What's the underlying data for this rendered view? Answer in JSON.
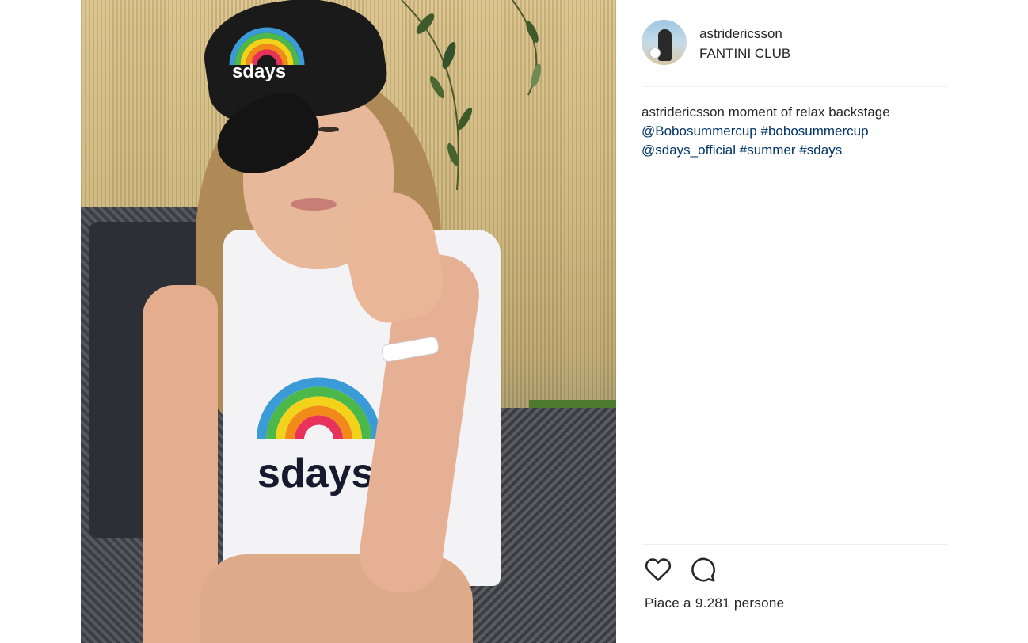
{
  "post": {
    "photo_icon": "post-photo",
    "cap_logo_text": "sdays",
    "shirt_logo_text": "sdays"
  },
  "header": {
    "username": "astridericsson",
    "location": "FANTINI CLUB",
    "avatar_icon": "avatar"
  },
  "caption": {
    "author": "astridericsson",
    "text": "moment of relax backstage",
    "mention_1": "@Bobosummercup",
    "hashtag_1": "#bobosummercup",
    "mention_2": "@sdays_official",
    "hashtag_2": "#summer",
    "hashtag_3": "#sdays"
  },
  "actions": {
    "like_icon": "heart-icon",
    "comment_icon": "comment-icon"
  },
  "likes_text": "Piace a 9.281 persone",
  "colors": {
    "link": "#003569",
    "text": "#262626",
    "divider": "#efefef"
  }
}
